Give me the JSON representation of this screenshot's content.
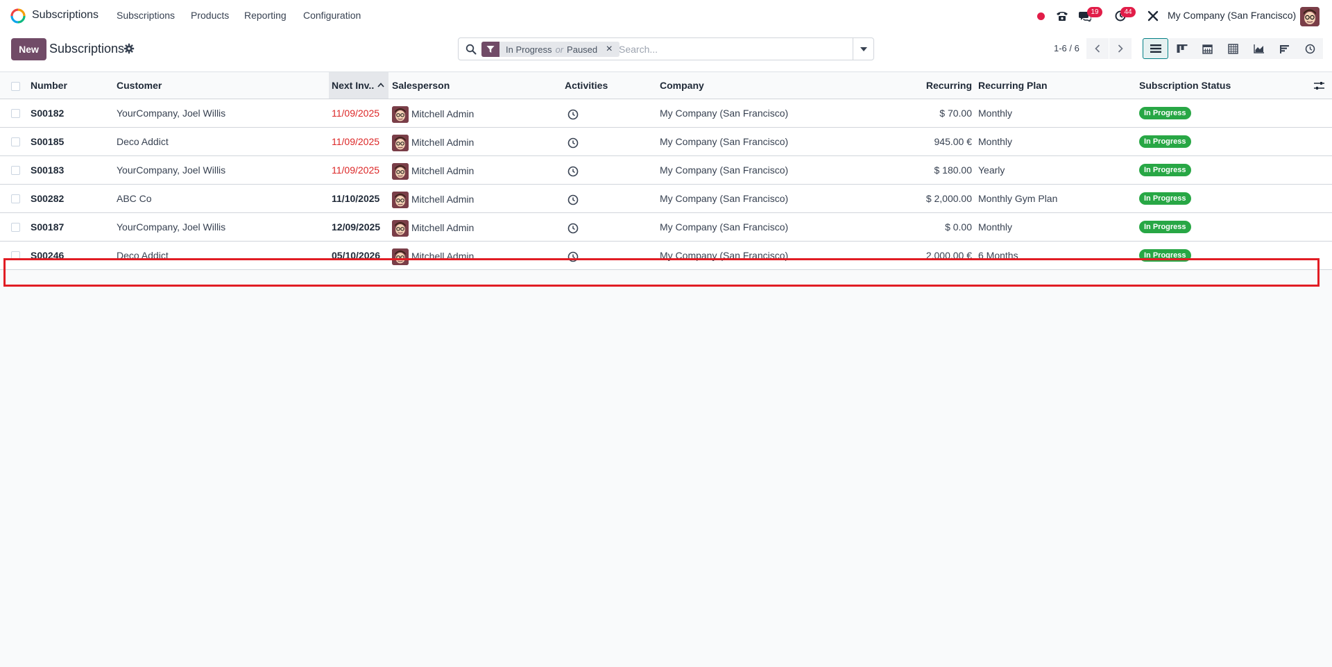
{
  "app": {
    "name": "Subscriptions"
  },
  "nav": {
    "menu": [
      "Subscriptions",
      "Products",
      "Reporting",
      "Configuration"
    ],
    "messages_badge": "19",
    "activities_badge": "44",
    "company": "My Company (San Francisco)"
  },
  "control": {
    "new_label": "New",
    "title": "Subscriptions",
    "facet": {
      "value1": "In Progress",
      "or": "or",
      "value2": "Paused"
    },
    "search_placeholder": "Search...",
    "pager": "1-6 / 6"
  },
  "columns": {
    "number": "Number",
    "customer": "Customer",
    "next_invoice": "Next Inv..",
    "salesperson": "Salesperson",
    "activities": "Activities",
    "company": "Company",
    "recurring": "Recurring",
    "recurring_plan": "Recurring Plan",
    "status": "Subscription Status"
  },
  "rows": [
    {
      "number": "S00182",
      "customer": "YourCompany, Joel Willis",
      "next_invoice": "11/09/2025",
      "salesperson": "Mitchell Admin",
      "company": "My Company (San Francisco)",
      "recurring": "$ 70.00",
      "plan": "Monthly",
      "status": "In Progress"
    },
    {
      "number": "S00185",
      "customer": "Deco Addict",
      "next_invoice": "11/09/2025",
      "salesperson": "Mitchell Admin",
      "company": "My Company (San Francisco)",
      "recurring": "945.00 €",
      "plan": "Monthly",
      "status": "In Progress"
    },
    {
      "number": "S00183",
      "customer": "YourCompany, Joel Willis",
      "next_invoice": "11/09/2025",
      "salesperson": "Mitchell Admin",
      "company": "My Company (San Francisco)",
      "recurring": "$ 180.00",
      "plan": "Yearly",
      "status": "In Progress"
    },
    {
      "number": "S00282",
      "customer": "ABC Co",
      "next_invoice": "11/10/2025",
      "salesperson": "Mitchell Admin",
      "company": "My Company (San Francisco)",
      "recurring": "$ 2,000.00",
      "plan": "Monthly Gym Plan",
      "status": "In Progress"
    },
    {
      "number": "S00187",
      "customer": "YourCompany, Joel Willis",
      "next_invoice": "12/09/2025",
      "salesperson": "Mitchell Admin",
      "company": "My Company (San Francisco)",
      "recurring": "$ 0.00",
      "plan": "Monthly",
      "status": "In Progress"
    },
    {
      "number": "S00246",
      "customer": "Deco Addict",
      "next_invoice": "05/10/2026",
      "salesperson": "Mitchell Admin",
      "company": "My Company (San Francisco)",
      "recurring": "2,000.00 €",
      "plan": "6 Months",
      "status": "In Progress"
    }
  ],
  "colors": {
    "brand": "#714b67",
    "overdue": "#dc2626",
    "status_green": "#28a745",
    "highlight": "#e11d24"
  },
  "icons": [
    "app-logo-icon",
    "phone-icon",
    "chat-icon",
    "clock-icon",
    "debug-tools-icon",
    "gear-icon",
    "search-icon",
    "filter-icon",
    "close-icon",
    "caret-down-icon",
    "chevron-left-icon",
    "chevron-right-icon",
    "list-view-icon",
    "kanban-view-icon",
    "calendar-view-icon",
    "pivot-view-icon",
    "graph-view-icon",
    "cohort-view-icon",
    "activity-view-icon",
    "optional-columns-icon",
    "sort-ascending-icon"
  ]
}
